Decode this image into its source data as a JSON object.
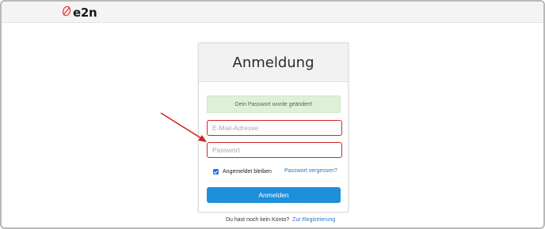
{
  "header": {
    "logo_text": "e2n",
    "logo_icon": "e2n-logo-icon"
  },
  "login": {
    "title": "Anmeldung",
    "success_message": "Dein Passwort wurde geändert!",
    "email_placeholder": "E-Mail-Adresse",
    "password_placeholder": "Passwort",
    "remember_label": "Angemeldet bleiben",
    "remember_checked": true,
    "forgot_link": "Passwort vergessen?",
    "submit_label": "Anmelden"
  },
  "footer": {
    "no_account_text": "Du hast noch kein Konto?",
    "register_link": "Zur Registrierung"
  },
  "colors": {
    "accent": "#1e8fd9",
    "highlight_red": "#d22525",
    "success_bg": "#dff0d8",
    "success_text": "#3c763d",
    "link": "#2a76c6"
  }
}
